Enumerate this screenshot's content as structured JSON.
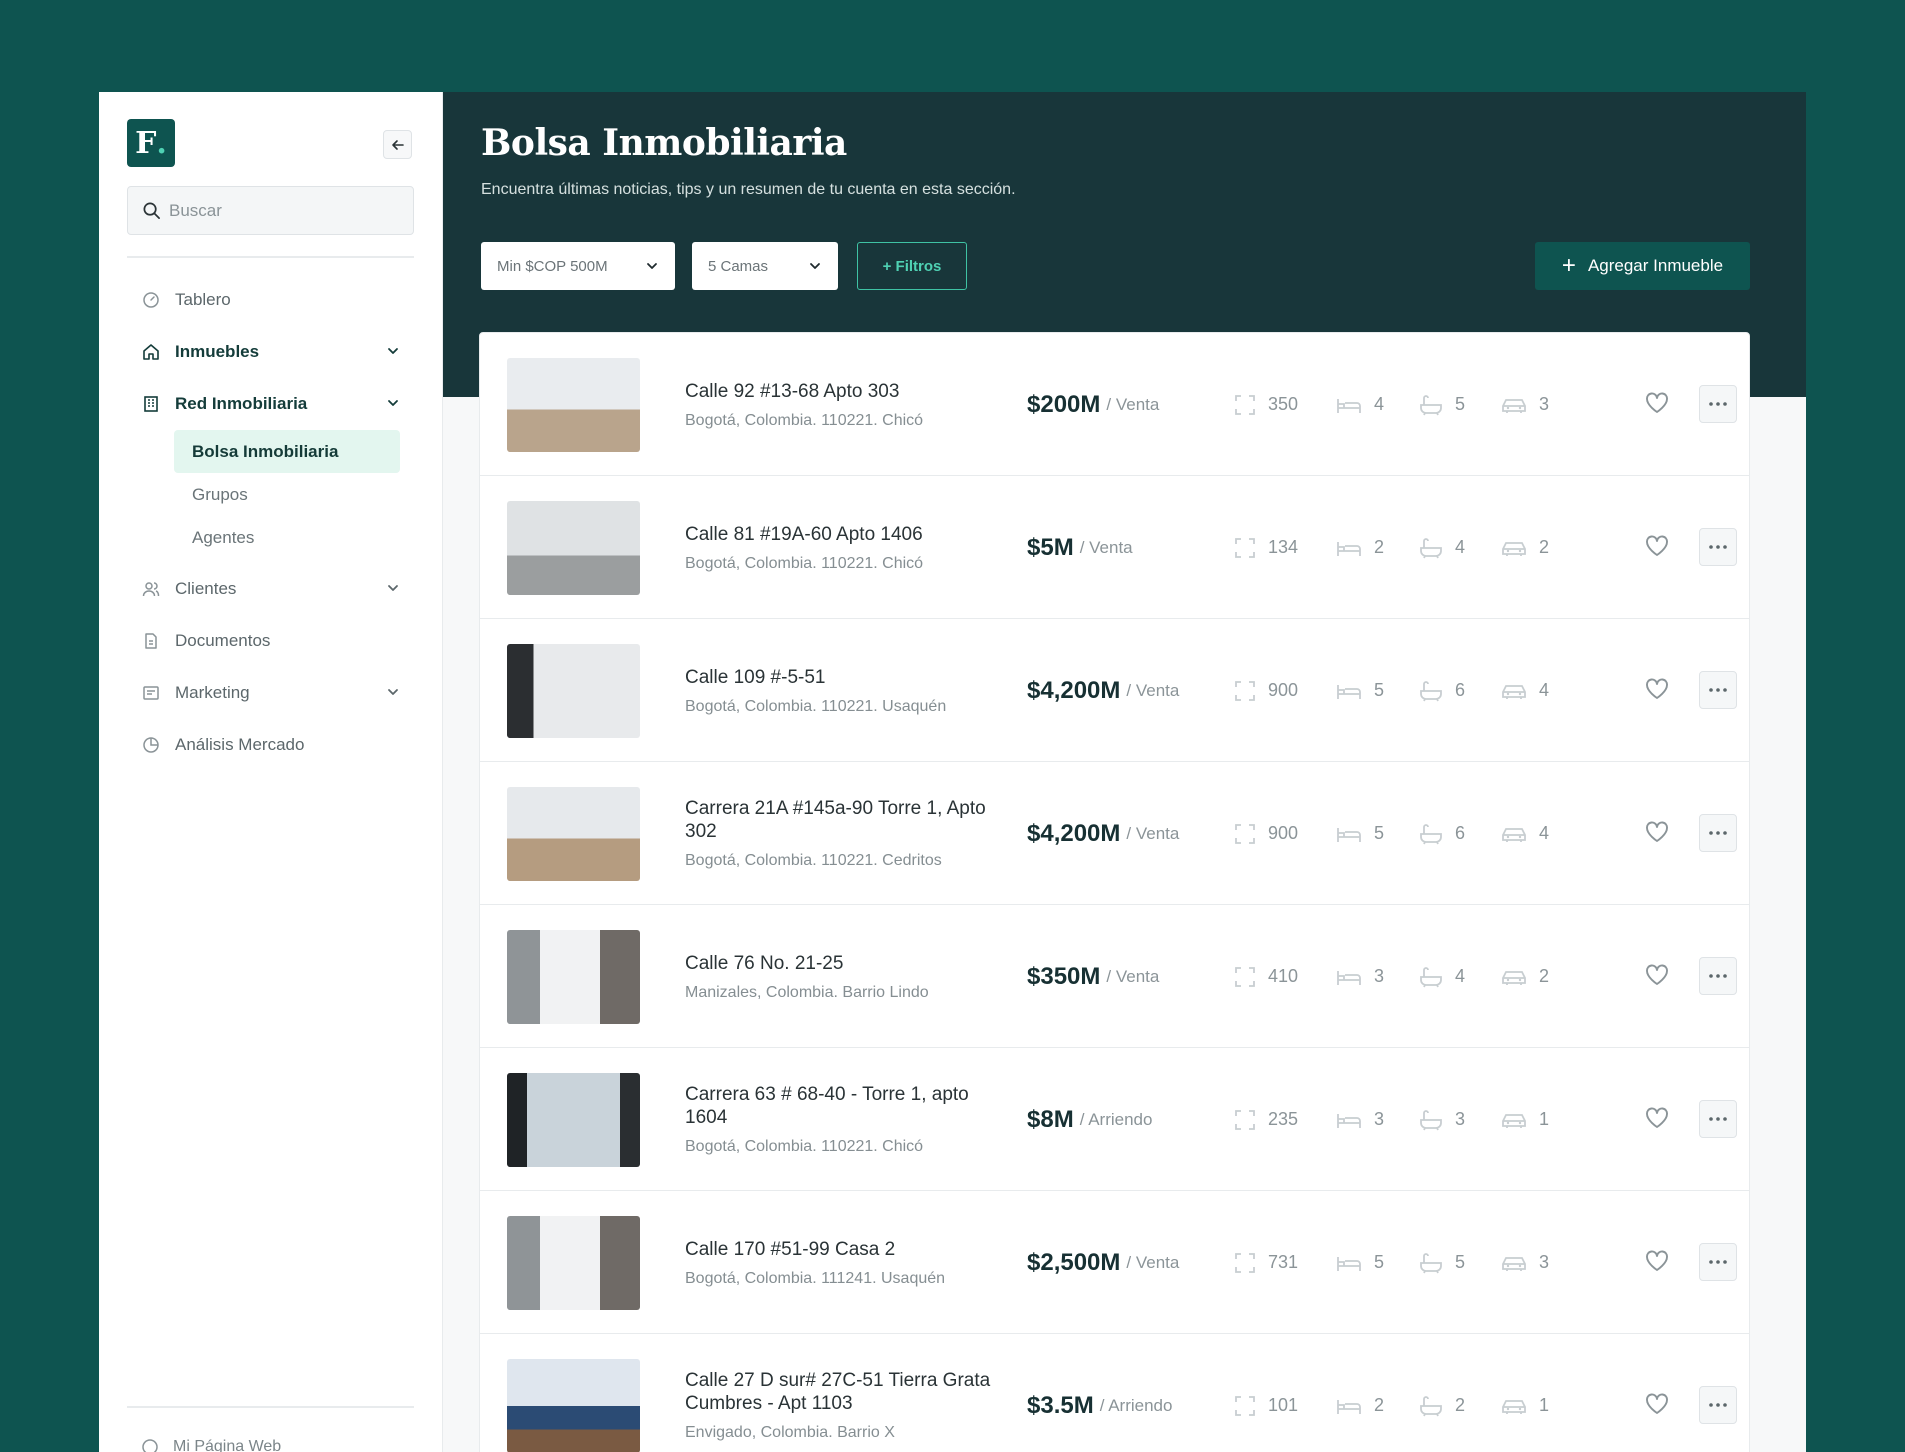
{
  "app": {
    "logo_letter": "F",
    "logo_dot": ".",
    "search_placeholder": "Buscar",
    "footer_link": "Mi Página Web"
  },
  "sidebar": {
    "items": [
      {
        "label": "Tablero",
        "icon": "gauge-icon"
      },
      {
        "label": "Inmuebles",
        "icon": "home-icon"
      },
      {
        "label": "Red Inmobiliaria",
        "icon": "building-icon"
      },
      {
        "label": "Clientes",
        "icon": "users-icon"
      },
      {
        "label": "Documentos",
        "icon": "document-icon"
      },
      {
        "label": "Marketing",
        "icon": "marketing-icon"
      },
      {
        "label": "Análisis Mercado",
        "icon": "pie-chart-icon"
      }
    ],
    "subitems": [
      "Bolsa Inmobiliaria",
      "Grupos",
      "Agentes"
    ]
  },
  "header": {
    "title": "Bolsa Inmobiliaria",
    "subtitle": "Encuentra últimas noticias, tips y un resumen de tu cuenta en esta sección.",
    "filter_price": "Min $COP 500M",
    "filter_beds": "5 Camas",
    "filters_button": "+ Filtros",
    "add_button": "Agregar Inmueble",
    "add_icon": "+"
  },
  "listings": [
    {
      "street": "Calle 92 #13-68 Apto 303",
      "city": "Bogotá, Colombia. 110221. Chicó",
      "price": "$200M",
      "type": "/ Venta",
      "area": "350",
      "beds": "4",
      "baths": "5",
      "parking": "3"
    },
    {
      "street": "Calle 81 #19A-60 Apto 1406",
      "city": "Bogotá, Colombia. 110221. Chicó",
      "price": "$5M",
      "type": "/ Venta",
      "area": "134",
      "beds": "2",
      "baths": "4",
      "parking": "2"
    },
    {
      "street": "Calle 109 #-5-51",
      "city": "Bogotá, Colombia. 110221. Usaquén",
      "price": "$4,200M",
      "type": "/ Venta",
      "area": "900",
      "beds": "5",
      "baths": "6",
      "parking": "4"
    },
    {
      "street": "Carrera 21A #145a-90 Torre 1, Apto 302",
      "city": "Bogotá, Colombia. 110221. Cedritos",
      "price": "$4,200M",
      "type": "/ Venta",
      "area": "900",
      "beds": "5",
      "baths": "6",
      "parking": "4"
    },
    {
      "street": "Calle 76 No. 21-25",
      "city": "Manizales, Colombia. Barrio Lindo",
      "price": "$350M",
      "type": "/ Venta",
      "area": "410",
      "beds": "3",
      "baths": "4",
      "parking": "2"
    },
    {
      "street": "Carrera 63 # 68-40 - Torre 1, apto 1604",
      "city": "Bogotá, Colombia. 110221. Chicó",
      "price": "$8M",
      "type": "/ Arriendo",
      "area": "235",
      "beds": "3",
      "baths": "3",
      "parking": "1"
    },
    {
      "street": "Calle 170 #51-99 Casa 2",
      "city": "Bogotá, Colombia. 111241. Usaquén",
      "price": "$2,500M",
      "type": "/ Venta",
      "area": "731",
      "beds": "5",
      "baths": "5",
      "parking": "3"
    },
    {
      "street": "Calle 27 D sur# 27C-51 Tierra Grata Cumbres - Apt 1103",
      "city": "Envigado, Colombia. Barrio X",
      "price": "$3.5M",
      "type": "/ Arriendo",
      "area": "101",
      "beds": "2",
      "baths": "2",
      "parking": "1"
    }
  ],
  "colors": {
    "background": "#0e5450",
    "header": "#18363a",
    "accent": "#4fd1b3",
    "selected_bg": "#e3f6ef"
  }
}
